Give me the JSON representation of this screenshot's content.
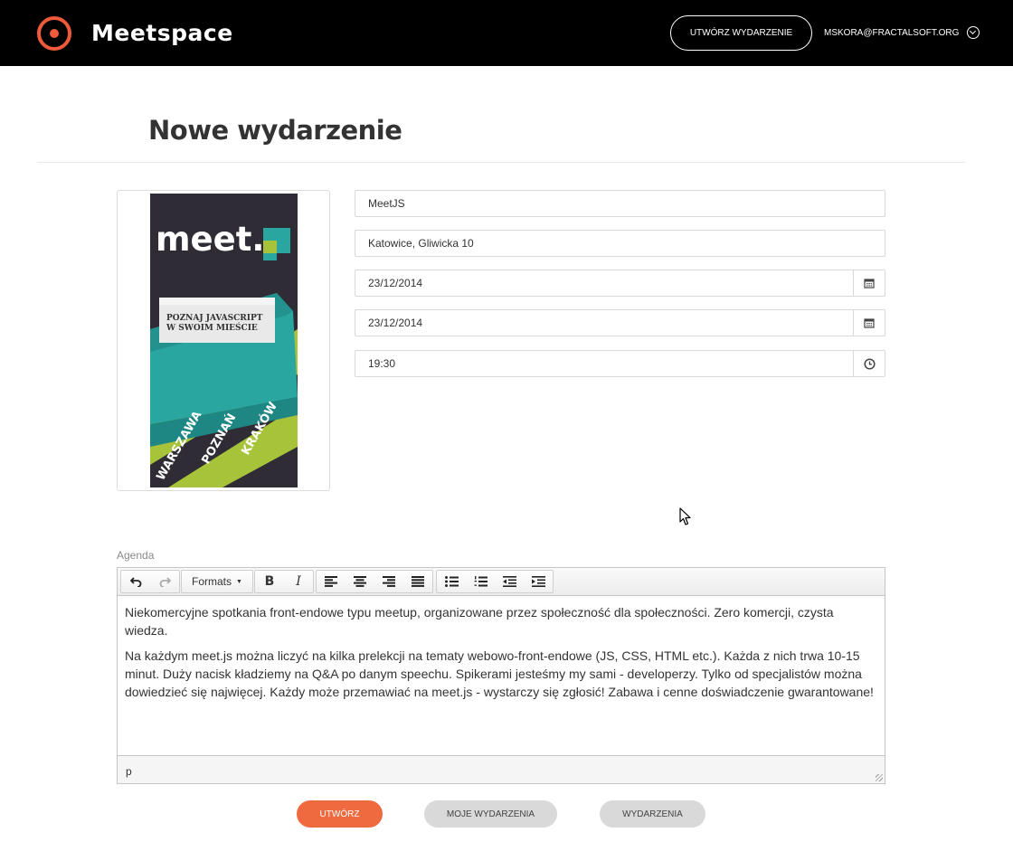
{
  "header": {
    "brand": "Meetspace",
    "create_event_label": "UTWÓRZ WYDARZENIE",
    "user_email": "MSKORA@FRACTALSOFT.ORG",
    "accent_color": "#ef5a3a"
  },
  "page": {
    "title": "Nowe wydarzenie"
  },
  "poster": {
    "logo_text": "meet.",
    "tagline_line1": "POZNAJ JAVASCRIPT",
    "tagline_line2": "W SWOIM MIEŚCIE",
    "cities": [
      "WARSZAWA",
      "POZNAŃ",
      "KRAKÓW"
    ]
  },
  "form": {
    "name": "MeetJS",
    "address": "Katowice, Gliwicka 10",
    "start_date": "23/12/2014",
    "end_date": "23/12/2014",
    "time": "19:30"
  },
  "agenda": {
    "label": "Agenda",
    "formats_label": "Formats",
    "paragraph1": "Niekomercyjne spotkania front-endowe typu meetup, organizowane przez społeczność dla społeczności. Zero komercji, czysta wiedza.",
    "paragraph2": "Na każdym meet.js można liczyć na kilka prelekcji na tematy webowo-front-endowe (JS, CSS, HTML etc.). Każda z nich trwa 10-15 minut. Duży nacisk kładziemy na Q&A po danym speechu. Spikerami jesteśmy my sami - developerzy. Tylko od specjalistów można dowiedzieć się najwięcej. Każdy może przemawiać na meet.js - wystarczy się zgłosić! Zabawa i cenne doświadczenie gwarantowane!",
    "status_path": "p"
  },
  "actions": {
    "create_label": "UTWÓRZ",
    "my_events_label": "MOJE WYDARZENIA",
    "events_label": "WYDARZENIA"
  }
}
